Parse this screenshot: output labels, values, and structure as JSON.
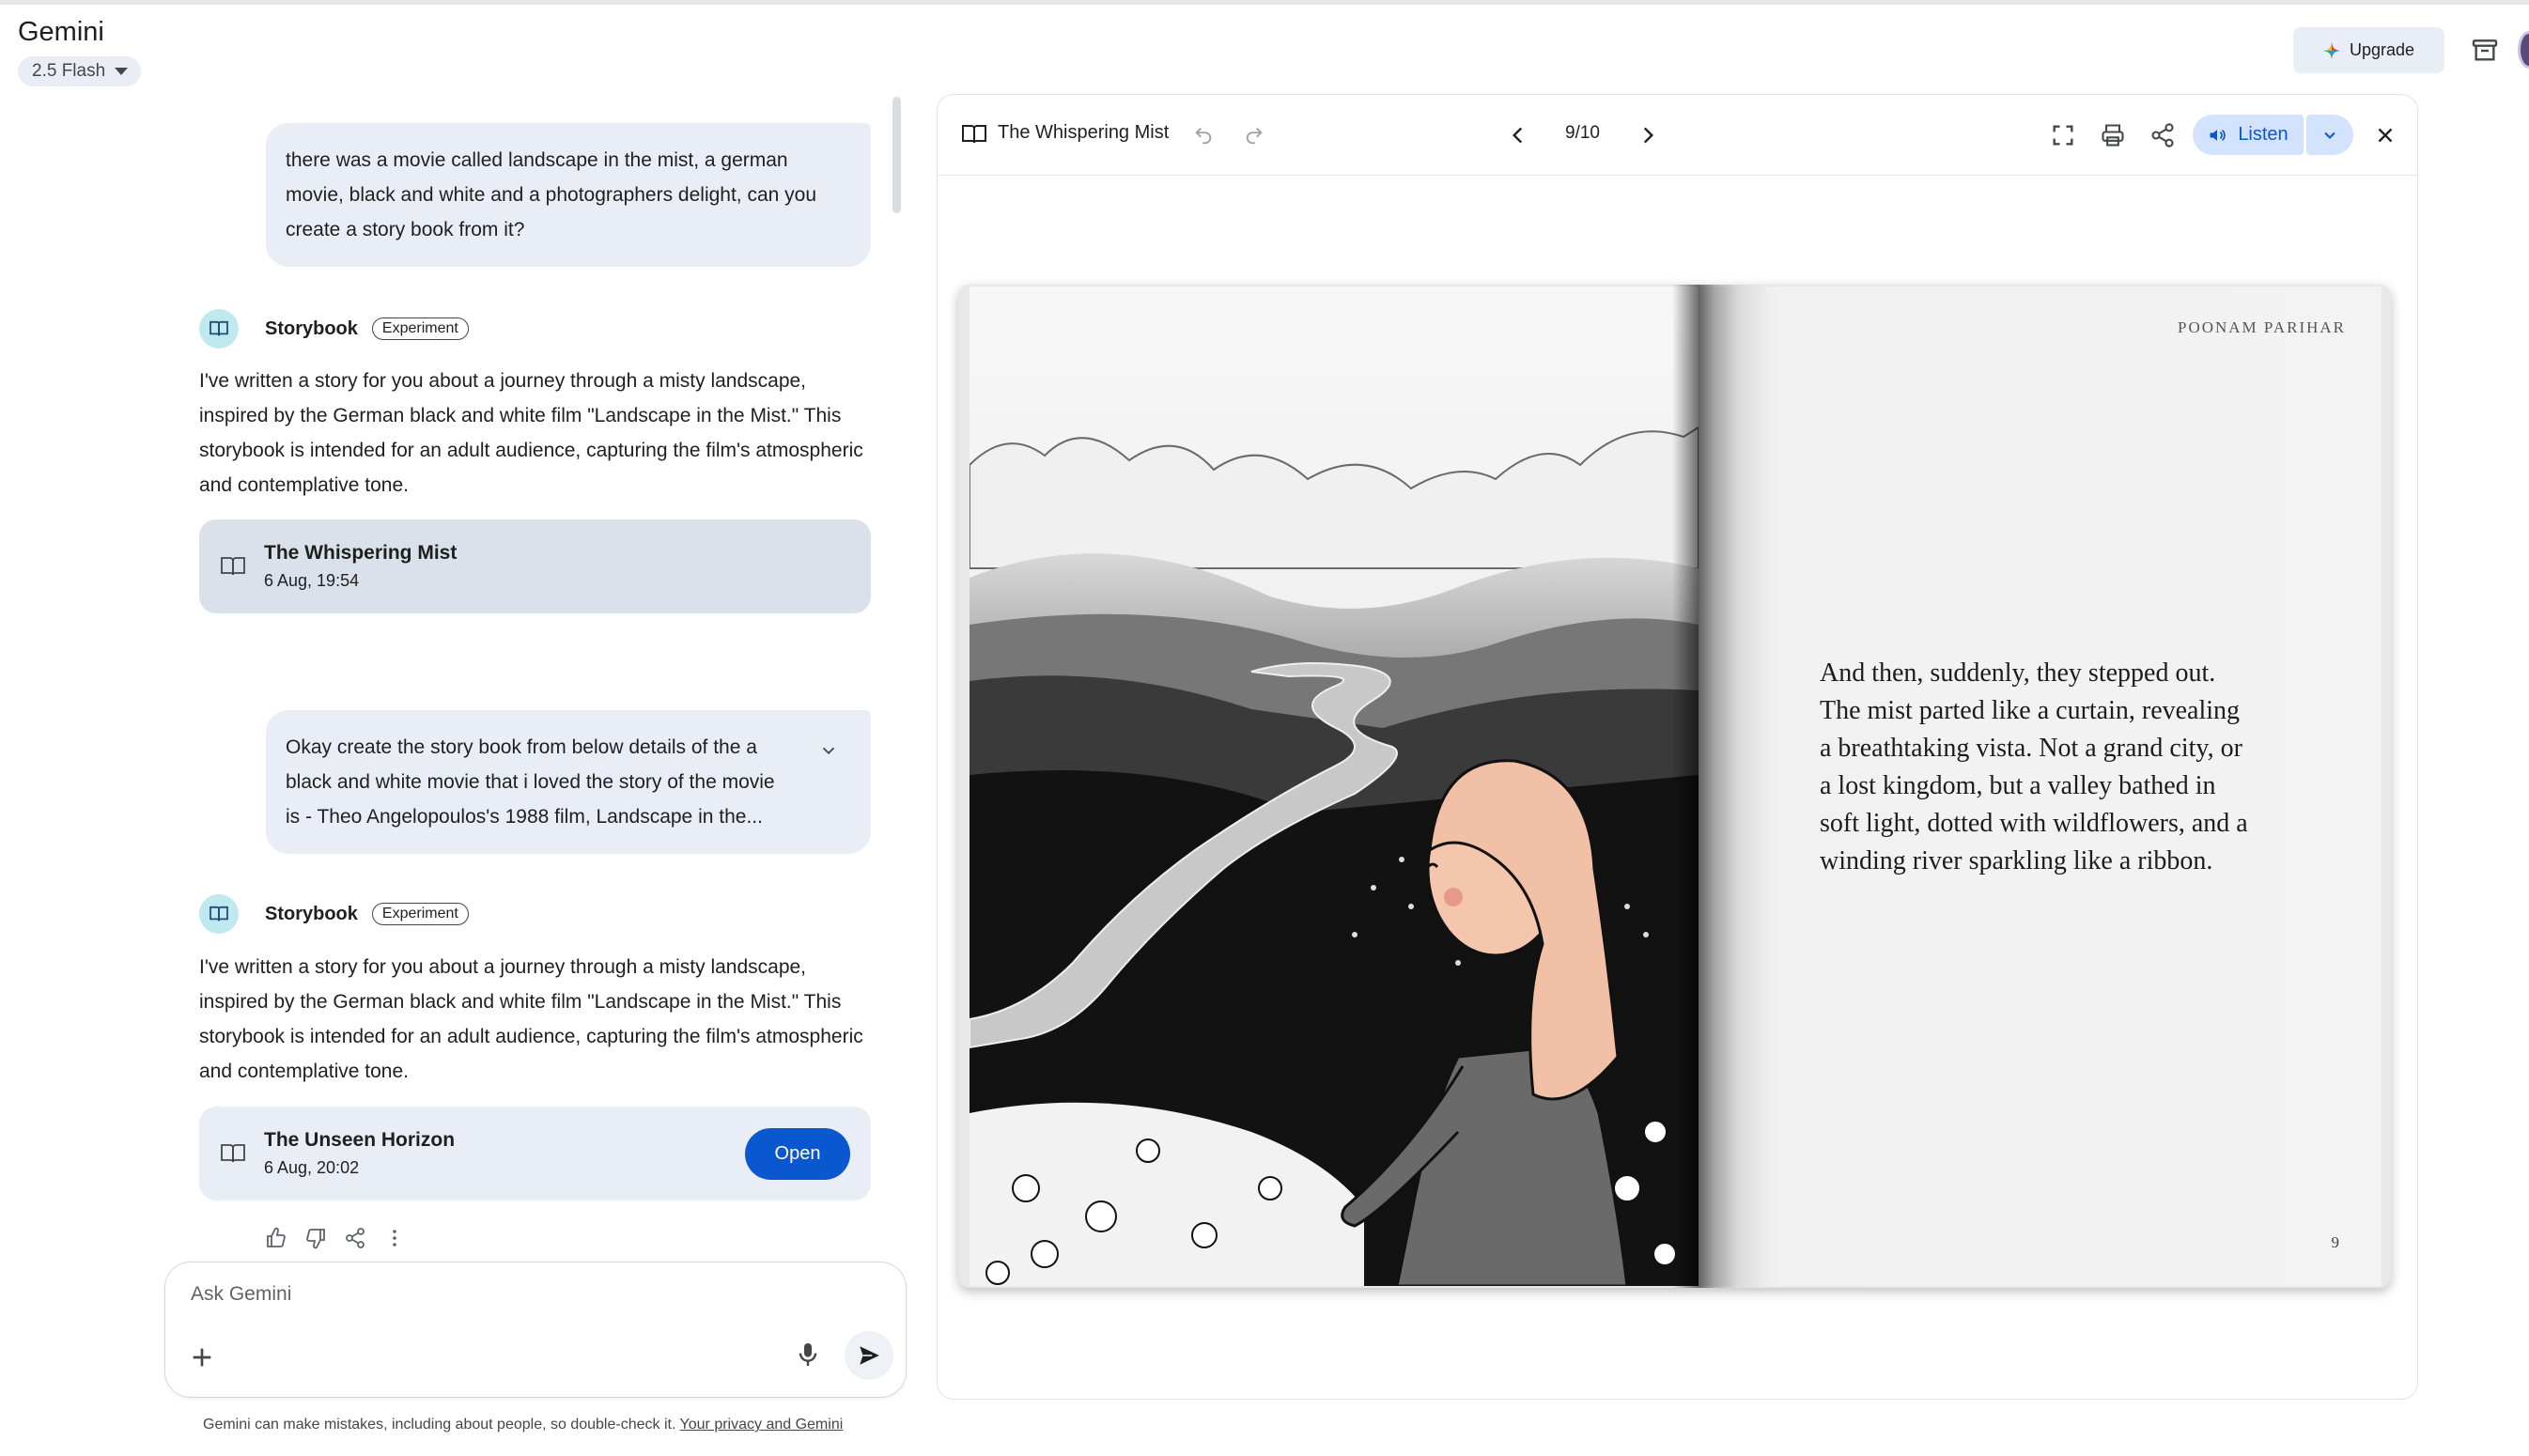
{
  "app": {
    "title": "Gemini",
    "model": "2.5 Flash"
  },
  "header": {
    "upgrade_label": "Upgrade"
  },
  "chat": {
    "messages": [
      {
        "role": "user",
        "text": "there was a movie called landscape in the mist, a german movie, black and white and a photographers delight, can you create a story book from it?"
      },
      {
        "role": "model",
        "name": "Storybook",
        "badge": "Experiment",
        "text": "I've written a story for you about a journey through a misty landscape, inspired by the German black and white film \"Landscape in the Mist.\" This storybook is intended for an adult audience, capturing the film's atmospheric and contemplative tone.",
        "card": {
          "title": "The Whispering Mist",
          "date": "6 Aug, 19:54"
        }
      },
      {
        "role": "user",
        "text": "Okay create the story book from below details of the a black and white movie that i loved the story of the movie is - Theo Angelopoulos's 1988 film, Landscape in the..."
      },
      {
        "role": "model",
        "name": "Storybook",
        "badge": "Experiment",
        "text": "I've written a story for you about a journey through a misty landscape, inspired by the German black and white film \"Landscape in the Mist.\" This storybook is intended for an adult audience, capturing the film's atmospheric and contemplative tone.",
        "card": {
          "title": "The Unseen Horizon",
          "date": "6 Aug, 20:02",
          "open_label": "Open"
        }
      }
    ]
  },
  "input": {
    "placeholder": "Ask Gemini"
  },
  "disclaimer": {
    "text": "Gemini can make mistakes, including about people, so double-check it. ",
    "link": "Your privacy and Gemini"
  },
  "panel": {
    "title": "The Whispering Mist",
    "page_indicator": "9/10",
    "listen_label": "Listen",
    "book": {
      "author": "POONAM PARIHAR",
      "text": "And then, suddenly, they stepped out. The mist parted like a curtain, revealing a breathtaking vista. Not a grand city, or a lost kingdom, but a valley bathed in soft light, dotted with wildflowers, and a winding river sparkling like a ribbon.",
      "page_number": "9"
    }
  },
  "colors": {
    "accent": "#0b57d0",
    "listen_bg": "#d3e3fd",
    "bubble": "#e9eef6",
    "card_active": "#dbe1ea"
  }
}
